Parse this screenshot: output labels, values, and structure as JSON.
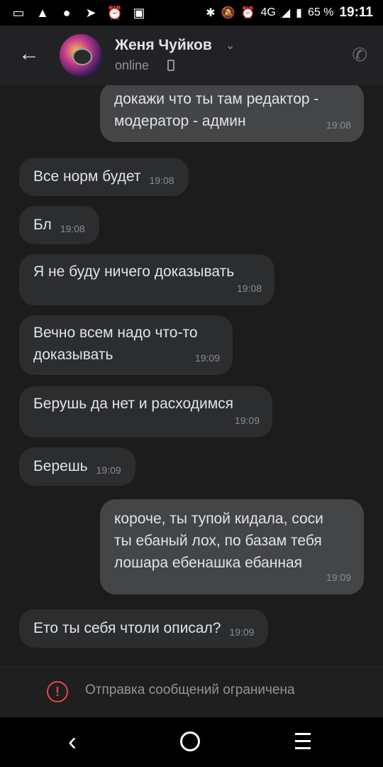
{
  "statusbar": {
    "left_icons": [
      "messages-icon",
      "warning-icon",
      "chat-icon",
      "telegram-icon",
      "alarm-icon",
      "sms-icon"
    ],
    "network": "4G",
    "battery": "65 %",
    "time": "19:11"
  },
  "header": {
    "name": "Женя Чуйков",
    "status": "online"
  },
  "messages": [
    {
      "dir": "out",
      "text": "докажи что ты там редактор -\nмодератор - админ",
      "time": "19:08"
    },
    {
      "dir": "in",
      "text": "Все норм будет",
      "time": "19:08"
    },
    {
      "dir": "in",
      "text": "Бл",
      "time": "19:08"
    },
    {
      "dir": "in",
      "text": "Я не буду ничего доказывать",
      "time": "19:08"
    },
    {
      "dir": "in",
      "text": "Вечно всем надо что-то\nдоказывать",
      "time": "19:09"
    },
    {
      "dir": "in",
      "text": "Берушь да нет и расходимся",
      "time": "19:09"
    },
    {
      "dir": "in",
      "text": "Берешь",
      "time": "19:09"
    },
    {
      "dir": "out",
      "text": "короче, ты тупой кидала, соси\nты ебаный лох, по базам тебя\nлошара ебенашка ебанная",
      "time": "19:09"
    },
    {
      "dir": "in",
      "text": "Ето ты себя чтоли описал?",
      "time": "19:09"
    }
  ],
  "footer": {
    "restriction": "Отправка сообщений ограничена"
  },
  "colors": {
    "background": "#1c1c1d",
    "incoming_bubble": "#2c2d2e",
    "outgoing_bubble": "#444547",
    "warning": "#e64646"
  }
}
